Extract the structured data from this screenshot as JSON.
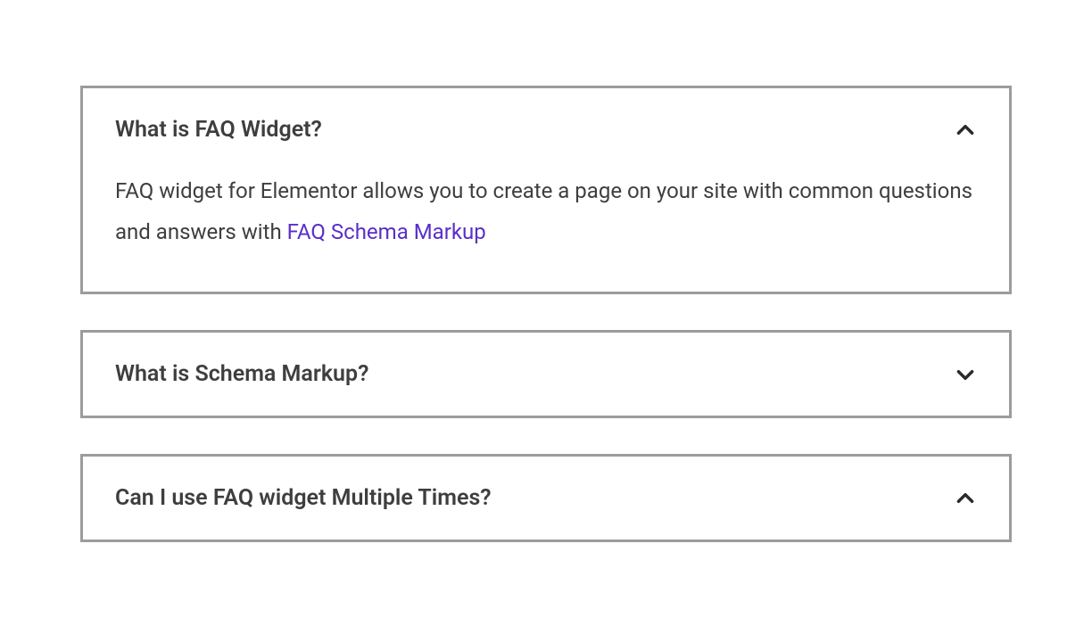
{
  "faq": {
    "items": [
      {
        "question": "What is FAQ Widget?",
        "expanded": true,
        "answer_prefix": "FAQ widget for Elementor allows you to create a page on your site with common questions and answers with ",
        "answer_link_text": "FAQ Schema Markup"
      },
      {
        "question": "What is Schema Markup?",
        "expanded": false
      },
      {
        "question": "Can I use FAQ widget Multiple Times?",
        "expanded": true
      }
    ]
  }
}
